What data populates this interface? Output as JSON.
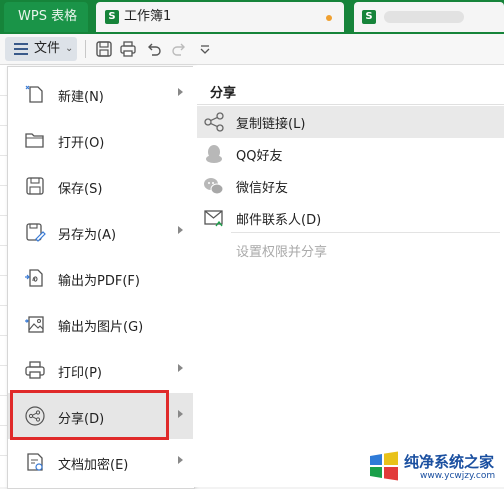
{
  "tabs": {
    "wps_label": "WPS 表格",
    "workbook_label": "工作簿1",
    "logo_letter": "S"
  },
  "toolbar": {
    "file_label": "文件",
    "icons": [
      "save-icon",
      "print-icon",
      "undo-icon",
      "redo-icon",
      "customize-toolbar-icon"
    ]
  },
  "menu": {
    "items": [
      {
        "label": "新建(N)",
        "icon": "new-file-icon",
        "has_submenu": true
      },
      {
        "label": "打开(O)",
        "icon": "folder-icon",
        "has_submenu": false
      },
      {
        "label": "保存(S)",
        "icon": "save-icon",
        "has_submenu": false
      },
      {
        "label": "另存为(A)",
        "icon": "save-as-icon",
        "has_submenu": true
      },
      {
        "label": "输出为PDF(F)",
        "icon": "pdf-export-icon",
        "has_submenu": false
      },
      {
        "label": "输出为图片(G)",
        "icon": "image-export-icon",
        "has_submenu": false
      },
      {
        "label": "打印(P)",
        "icon": "print-icon",
        "has_submenu": true
      },
      {
        "label": "分享(D)",
        "icon": "share-icon",
        "has_submenu": true,
        "active": true
      },
      {
        "label": "文档加密(E)",
        "icon": "encrypt-icon",
        "has_submenu": true
      }
    ]
  },
  "submenu": {
    "title": "分享",
    "items": [
      {
        "label": "复制链接(L)",
        "icon": "share-link-icon",
        "active": true
      },
      {
        "label": "QQ好友",
        "icon": "qq-icon"
      },
      {
        "label": "微信好友",
        "icon": "wechat-icon"
      },
      {
        "label": "邮件联系人(D)",
        "icon": "mail-icon"
      },
      {
        "label": "设置权限并分享",
        "disabled": true
      }
    ]
  },
  "watermark": {
    "text": "纯净系统之家",
    "url": "www.ycwjzy.com"
  },
  "colors": {
    "titlebar": "#16843a",
    "highlight_box": "#e02a2a",
    "watermark": "#1a4fa0"
  }
}
